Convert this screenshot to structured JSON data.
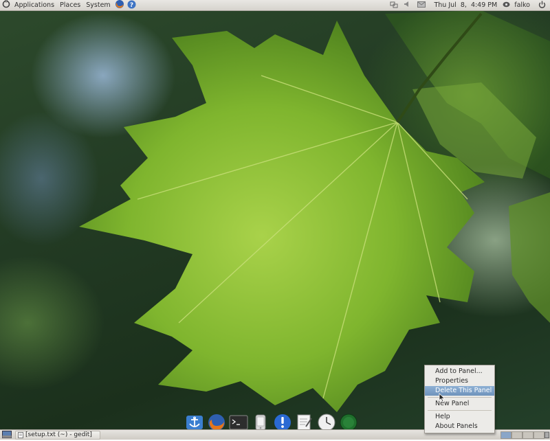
{
  "top_panel": {
    "menus": [
      "Applications",
      "Places",
      "System"
    ],
    "clock": "Thu Jul  8,  4:49 PM",
    "user": "falko"
  },
  "taskbar": {
    "window_title": "[setup.txt (~) - gedit]"
  },
  "dock": {
    "icons": [
      "anchor-icon",
      "firefox-icon",
      "terminal-icon",
      "iphone-icon",
      "info-icon",
      "text-editor-icon",
      "clock-icon",
      "green-orb-icon"
    ]
  },
  "context_menu": {
    "items": [
      "Add to Panel...",
      "Properties",
      "Delete This Panel",
      "New Panel",
      "Help",
      "About Panels"
    ],
    "highlighted": "Delete This Panel"
  },
  "colors": {
    "panel": "#d6d3cd",
    "menu_highlight": "#7aa0c8",
    "leaf": "#8cc23a"
  }
}
